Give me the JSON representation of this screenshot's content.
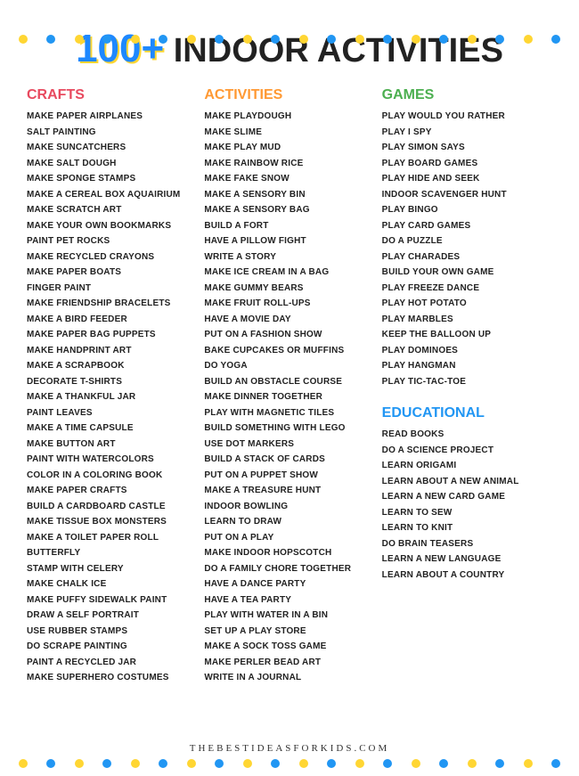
{
  "title": {
    "number": "100+",
    "text": " INDOOR ACTIVITIES"
  },
  "sections": {
    "crafts": {
      "header": "CRAFTS",
      "items": [
        "Make Paper Airplanes",
        "Salt Painting",
        "Make Suncatchers",
        "Make Salt Dough",
        "Make Sponge Stamps",
        "Make a Cereal Box Aquairium",
        "Make Scratch Art",
        "Make Your Own Bookmarks",
        "Paint Pet Rocks",
        "Make Recycled Crayons",
        "Make Paper Boats",
        "Finger Paint",
        "Make Friendship Bracelets",
        "Make a Bird Feeder",
        "Make Paper Bag Puppets",
        "Make Handprint Art",
        "Make a Scrapbook",
        "Decorate T-Shirts",
        "Make a Thankful Jar",
        "Paint Leaves",
        "Make a Time Capsule",
        "Make Button Art",
        "Paint with Watercolors",
        "Color in a Coloring Book",
        "Make Paper Crafts",
        "Build a Cardboard Castle",
        "Make Tissue Box Monsters",
        "Make a Toilet Paper Roll Butterfly",
        "Stamp with Celery",
        "Make Chalk Ice",
        "Make Puffy Sidewalk Paint",
        "Draw a Self Portrait",
        "Use Rubber Stamps",
        "Do Scrape Painting",
        "Paint a Recycled Jar",
        "Make Superhero Costumes"
      ]
    },
    "activities": {
      "header": "ACTIVITIES",
      "items": [
        "Make Playdough",
        "Make Slime",
        "Make Play Mud",
        "Make Rainbow Rice",
        "Make Fake Snow",
        "Make a Sensory Bin",
        "Make a Sensory Bag",
        "Build a Fort",
        "Have a Pillow Fight",
        "Write a Story",
        "Make Ice Cream in a Bag",
        "Make Gummy Bears",
        "Make Fruit Roll-Ups",
        "Have a Movie Day",
        "Put on a Fashion Show",
        "Bake Cupcakes or Muffins",
        "Do Yoga",
        "Build an Obstacle Course",
        "Make Dinner Together",
        "Play with Magnetic Tiles",
        "Build Something with Lego",
        "Use Dot Markers",
        "Build a Stack of Cards",
        "Put on a Puppet Show",
        "Make a Treasure Hunt",
        "Indoor Bowling",
        "Learn to Draw",
        "Put on a Play",
        "Make Indoor Hopscotch",
        "Do a Family Chore Together",
        "Have a Dance Party",
        "Have a Tea Party",
        "Play with Water in a Bin",
        "Set Up a Play Store",
        "Make a Sock Toss Game",
        "Make Perler Bead Art",
        "Write in a Journal"
      ]
    },
    "games": {
      "header": "GAMES",
      "items": [
        "Play Would You Rather",
        "Play I Spy",
        "Play Simon Says",
        "Play Board Games",
        "Play Hide and Seek",
        "Indoor Scavenger Hunt",
        "Play Bingo",
        "Play Card Games",
        "Do a Puzzle",
        "Play Charades",
        "Build Your Own Game",
        "Play Freeze Dance",
        "Play Hot Potato",
        "Play Marbles",
        "Keep the Balloon Up",
        "Play Dominoes",
        "Play Hangman",
        "Play Tic-Tac-Toe"
      ]
    },
    "educational": {
      "header": "EDUCATIONAL",
      "items": [
        "Read Books",
        "Do a Science Project",
        "Learn Origami",
        "Learn About a New Animal",
        "Learn a New Card Game",
        "Learn to Sew",
        "Learn to Knit",
        "Do Brain Teasers",
        "Learn a New Language",
        "Learn About a Country"
      ]
    }
  },
  "footer": "THEBESTIDEASFORKIDS.COM"
}
